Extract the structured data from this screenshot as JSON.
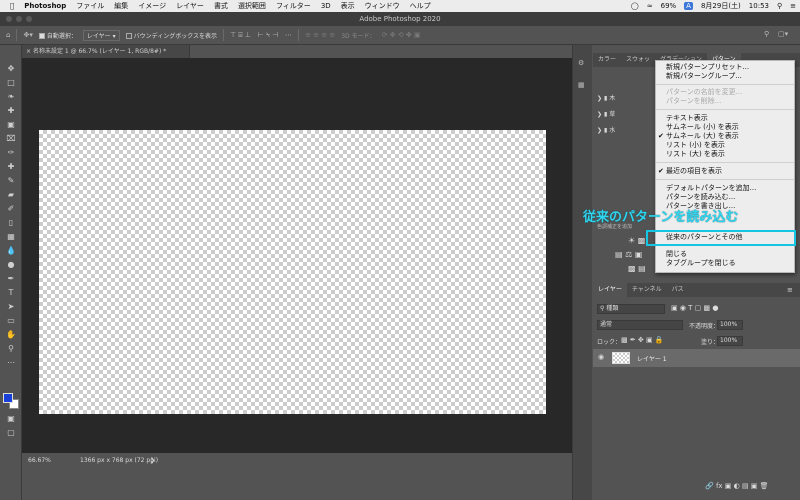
{
  "menubar": {
    "app": "Photoshop",
    "items": [
      "ファイル",
      "編集",
      "イメージ",
      "レイヤー",
      "書式",
      "選択範囲",
      "フィルター",
      "3D",
      "表示",
      "ウィンドウ",
      "ヘルプ"
    ],
    "battery": "69%",
    "input": "A",
    "date": "8月29日(土)",
    "time": "10:53"
  },
  "titlebar": {
    "title": "Adobe Photoshop 2020"
  },
  "options": {
    "auto_select": "自動選択：",
    "layer_select": "レイヤー",
    "bounding_box": "バウンディングボックスを表示",
    "mode_3d": "3D モード："
  },
  "document": {
    "tab": "名称未設定 1 @ 66.7% (レイヤー 1, RGB/8#) *",
    "zoom": "66.67%",
    "info": "1366 px x 768 px (72 ppi)"
  },
  "patterns_panel": {
    "tabs": [
      "カラー",
      "スウォッ",
      "グラデーション",
      "パターン"
    ],
    "groups": [
      "木",
      "草",
      "水"
    ]
  },
  "adjust_panel": {
    "hint": "色調補正を追加"
  },
  "layers_panel": {
    "tabs": [
      "レイヤー",
      "チャンネル",
      "パス"
    ],
    "filter": "種類",
    "blend": "通常",
    "opacity_label": "不透明度：",
    "opacity": "100%",
    "lock_label": "ロック：",
    "fill_label": "塗り：",
    "fill": "100%",
    "layer_name": "レイヤー 1"
  },
  "menu": {
    "items": [
      {
        "label": "新規パターンプリセット...",
        "disabled": false,
        "checked": false
      },
      {
        "label": "新規パターングループ...",
        "disabled": false,
        "checked": false
      },
      {
        "label": "パターンの名前を変更...",
        "disabled": true,
        "checked": false
      },
      {
        "label": "パターンを削除...",
        "disabled": true,
        "checked": false
      },
      {
        "label": "テキスト表示",
        "disabled": false,
        "checked": false
      },
      {
        "label": "サムネール (小) を表示",
        "disabled": false,
        "checked": false
      },
      {
        "label": "サムネール (大) を表示",
        "disabled": false,
        "checked": true
      },
      {
        "label": "リスト (小) を表示",
        "disabled": false,
        "checked": false
      },
      {
        "label": "リスト (大) を表示",
        "disabled": false,
        "checked": false
      },
      {
        "label": "最近の項目を表示",
        "disabled": false,
        "checked": true
      },
      {
        "label": "デフォルトパターンを追加...",
        "disabled": false,
        "checked": false
      },
      {
        "label": "パターンを読み込む...",
        "disabled": false,
        "checked": false
      },
      {
        "label": "パターンを書き出し...",
        "disabled": false,
        "checked": false
      },
      {
        "label": "従来のパターンとその他",
        "disabled": false,
        "checked": false
      },
      {
        "label": "閉じる",
        "disabled": false,
        "checked": false
      },
      {
        "label": "タブグループを閉じる",
        "disabled": false,
        "checked": false
      }
    ]
  },
  "annotation": {
    "text": "従来のパターンを読み込む",
    "color": "#2fd6ef"
  },
  "colors": {
    "menu_bg": "#ededed",
    "highlight": "#14c6e2",
    "foreground": "#1a40d8",
    "background": "#ffffff"
  }
}
